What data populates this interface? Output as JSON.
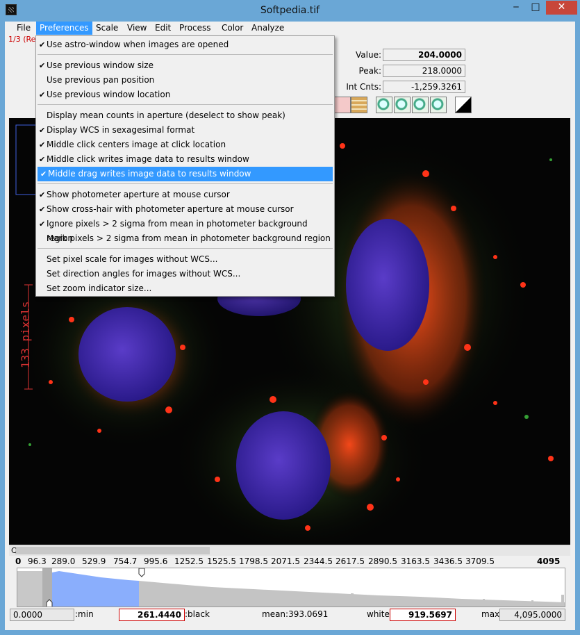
{
  "window": {
    "title": "Softpedia.tif",
    "min": "‒",
    "max": "□",
    "close": "✕"
  },
  "menubar": [
    "File",
    "Preferences",
    "Scale",
    "View",
    "Edit",
    "Process",
    "Color",
    "Analyze"
  ],
  "frame_label": "1/3 (Re",
  "readouts": {
    "value_label": "Value:",
    "value": "204.0000",
    "peak_label": "Peak:",
    "peak": "218.0000",
    "int_label": "Int Cnts:",
    "int": "-1,259.3261"
  },
  "scalebar": {
    "label": "133 pixels"
  },
  "histogram": {
    "axis_label": "C",
    "ticks": [
      "0",
      "96.3",
      "289.0",
      "529.9",
      "754.7",
      "995.6",
      "1252.5",
      "1525.5",
      "1798.5",
      "2071.5",
      "2344.5",
      "2617.5",
      "2890.5",
      "3163.5",
      "3436.5",
      "3709.5",
      "4095"
    ],
    "min_value": "0.0000",
    "min_label": ":min",
    "black_value": "261.4440",
    "black_label": ":black",
    "mean": "mean:393.0691",
    "white_label": "white:",
    "white_value": "919.5697",
    "max_label": "max:",
    "max_value": "4,095.0000"
  },
  "dropdown": {
    "items": [
      {
        "label": "Use astro-window when images are opened",
        "checked": true
      },
      {
        "label": "Use previous window size",
        "checked": true
      },
      {
        "label": "Use previous pan position",
        "checked": false
      },
      {
        "label": "Use previous window location",
        "checked": true
      },
      {
        "label": "Display mean counts in aperture (deselect to show peak)",
        "checked": false
      },
      {
        "label": "Display WCS in sexagesimal format",
        "checked": true
      },
      {
        "label": "Middle click centers image at click location",
        "checked": true
      },
      {
        "label": "Middle click writes image data to results window",
        "checked": true
      },
      {
        "label": "Middle drag writes image data to results window",
        "checked": true
      },
      {
        "label": "Show photometer aperture at mouse cursor",
        "checked": true
      },
      {
        "label": "Show cross-hair with photometer aperture at mouse cursor",
        "checked": true
      },
      {
        "label": "Ignore pixels > 2 sigma from mean in photometer background region",
        "checked": true
      },
      {
        "label": "Mark pixels > 2 sigma from mean in photometer background region",
        "checked": false
      },
      {
        "label": "Set pixel scale for images without WCS...",
        "checked": false
      },
      {
        "label": "Set direction angles for images without WCS...",
        "checked": false
      },
      {
        "label": "Set zoom indicator size...",
        "checked": false
      }
    ],
    "check_glyph": "✔"
  },
  "colors": {
    "accent": "#3399ff",
    "title_bar": "#6aa7d6",
    "close": "#c7463a",
    "histogram_fill": "#8aaefc"
  }
}
